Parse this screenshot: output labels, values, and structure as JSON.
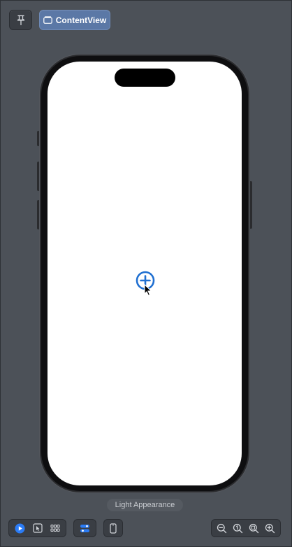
{
  "toolbar": {
    "pin_icon": "pin-icon",
    "content_view_label": "ContentView",
    "content_view_icon": "preview-window-icon",
    "accent": "#5b78a6"
  },
  "device": {
    "background": "#ffffff",
    "add_button_icon": "plus-circle-icon",
    "add_button_color": "#1f6fd1"
  },
  "footer": {
    "appearance_label": "Light Appearance",
    "mode_icons": [
      "live-preview-icon",
      "selectable-icon",
      "variants-grid-icon"
    ],
    "settings_icon": "device-settings-icon",
    "device_icon": "device-phone-icon",
    "zoom_icons": [
      "zoom-out-icon",
      "zoom-actual-size-icon",
      "zoom-to-fit-icon",
      "zoom-in-icon"
    ]
  }
}
